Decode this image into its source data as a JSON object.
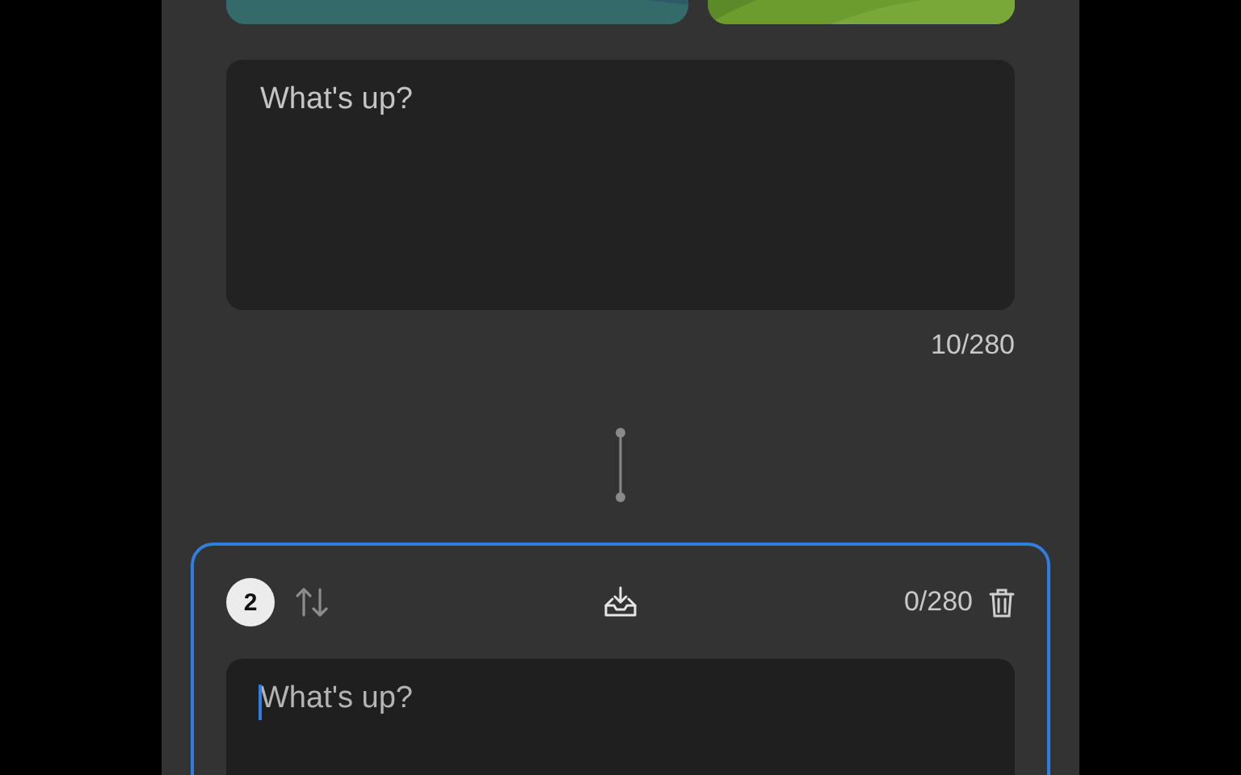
{
  "post": {
    "value": "What's up?",
    "count": "10/280"
  },
  "next_post": {
    "number": "2",
    "focused": true,
    "placeholder": "What's up?",
    "count": "0/280"
  }
}
